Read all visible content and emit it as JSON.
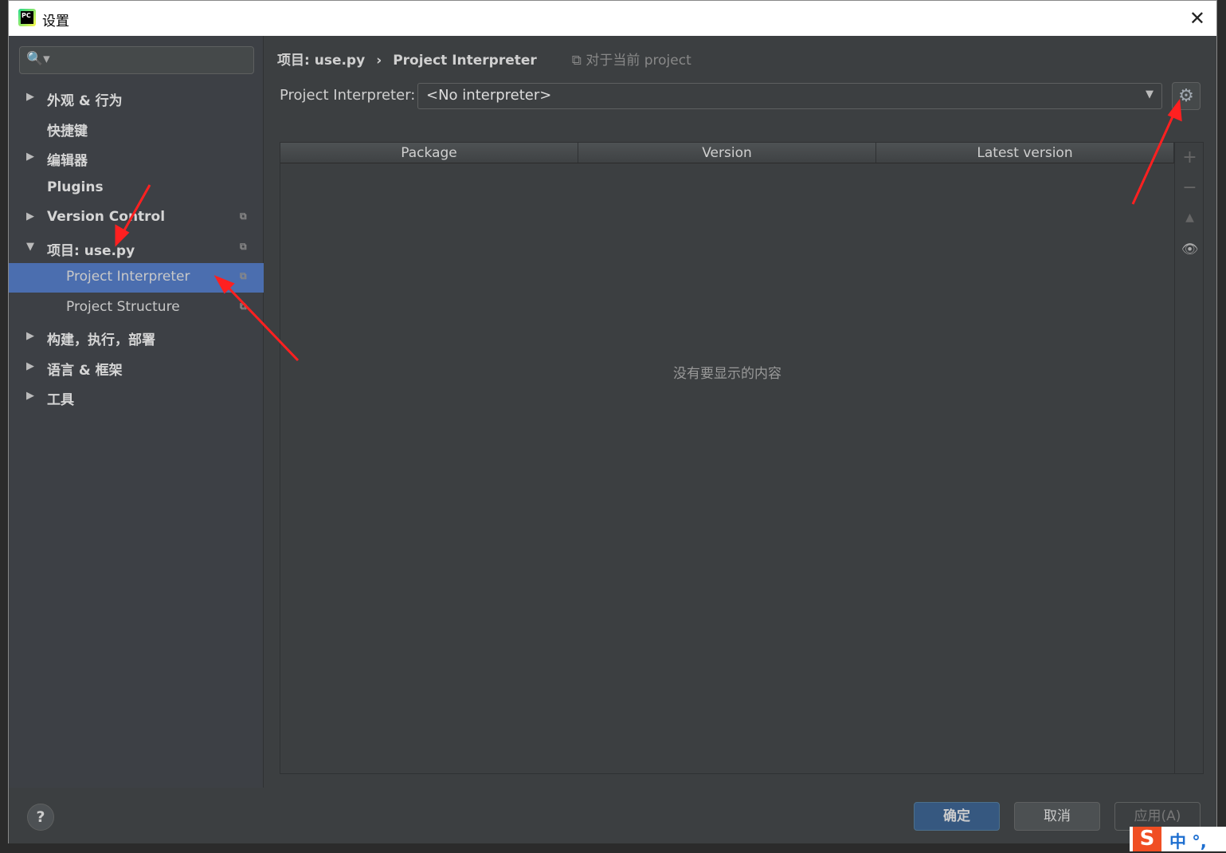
{
  "window": {
    "title": "设置",
    "logo": "PC",
    "close": "✕"
  },
  "search": {
    "icon": "🔍▾",
    "placeholder": ""
  },
  "sidebar": {
    "items": [
      {
        "label": "外观 & 行为",
        "arrow": "▶"
      },
      {
        "label": "快捷键",
        "arrow": ""
      },
      {
        "label": "编辑器",
        "arrow": "▶"
      },
      {
        "label": "Plugins",
        "arrow": ""
      },
      {
        "label": "Version Control",
        "arrow": "▶",
        "copy": "⧉"
      },
      {
        "label": "项目: use.py",
        "arrow": "▼",
        "copy": "⧉"
      },
      {
        "label": "Project Interpreter",
        "copy": "⧉",
        "selected": true
      },
      {
        "label": "Project Structure",
        "copy": "⧉"
      },
      {
        "label": "构建，执行，部署",
        "arrow": "▶"
      },
      {
        "label": "语言 & 框架",
        "arrow": "▶"
      },
      {
        "label": "工具",
        "arrow": "▶"
      }
    ]
  },
  "breadcrumb": {
    "project": "项目: use.py",
    "sep": "›",
    "page": "Project Interpreter",
    "note": "⧉ 对于当前 project"
  },
  "interpreter": {
    "label": "Project Interpreter:",
    "value": "<No interpreter>",
    "dropdown": "▼",
    "gear": "⚙"
  },
  "table": {
    "columns": [
      "Package",
      "Version",
      "Latest version"
    ],
    "empty": "没有要显示的内容",
    "tools": [
      "+",
      "−",
      "▲",
      "👁"
    ]
  },
  "footer": {
    "help": "?",
    "ok": "确定",
    "cancel": "取消",
    "apply": "应用(A)"
  },
  "ime": {
    "logo": "S",
    "text": "中 °,"
  }
}
